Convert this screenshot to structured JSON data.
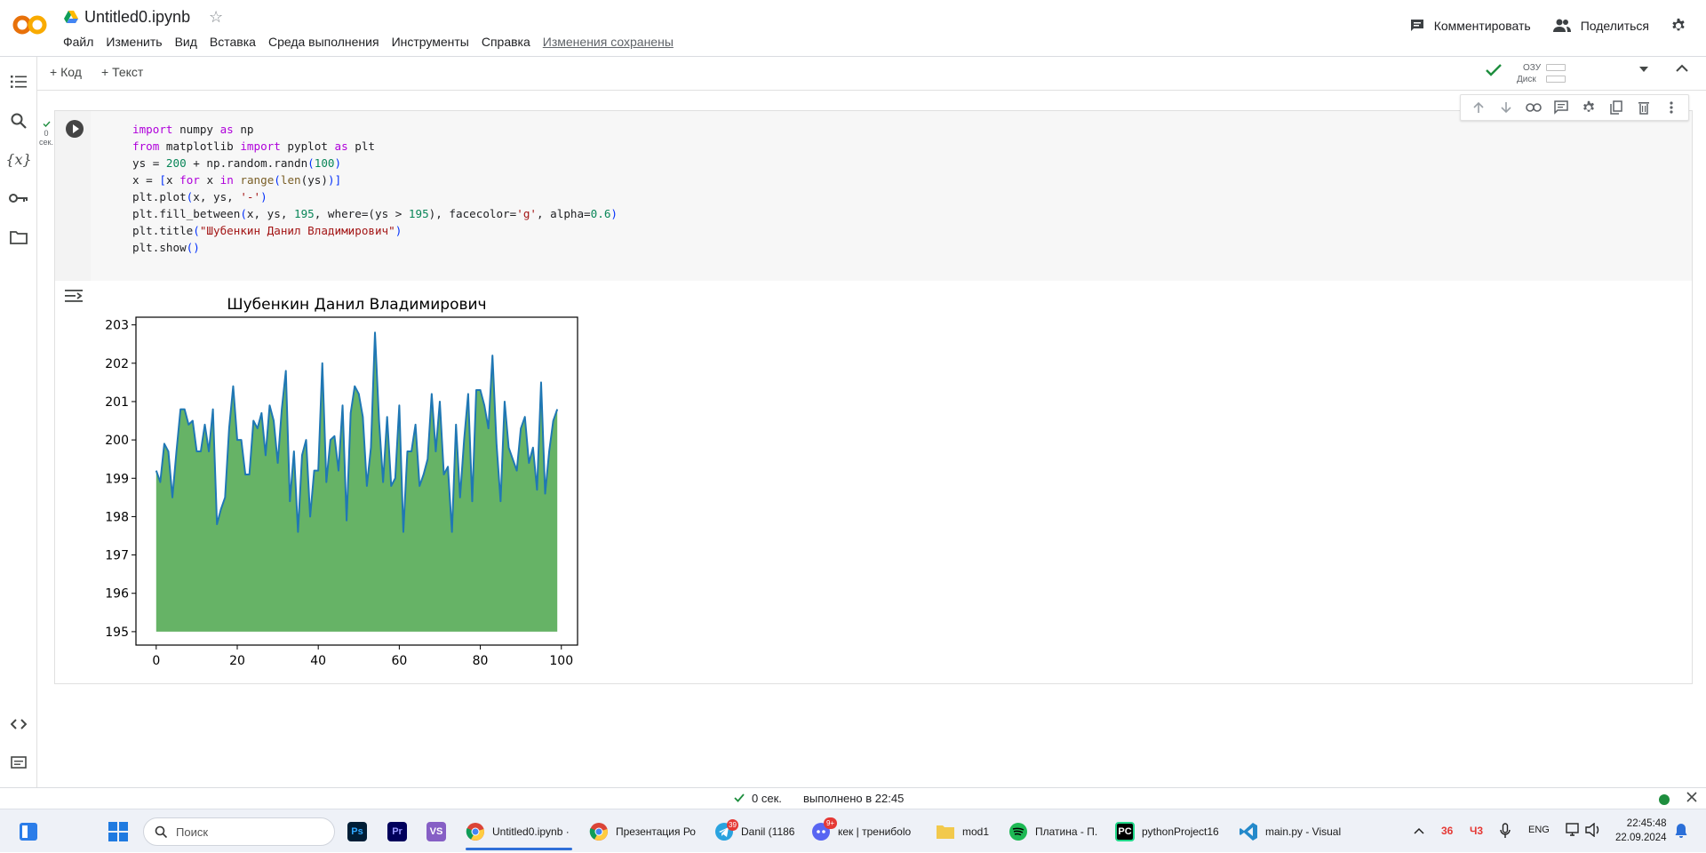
{
  "header": {
    "notebook_title": "Untitled0.ipynb",
    "menu": [
      "Файл",
      "Изменить",
      "Вид",
      "Вставка",
      "Среда выполнения",
      "Инструменты",
      "Справка"
    ],
    "saved_status": "Изменения сохранены",
    "comment_label": "Комментировать",
    "share_label": "Поделиться"
  },
  "toolbar": {
    "add_code": "+ Код",
    "add_text": "+ Текст",
    "ram_label": "ОЗУ",
    "disk_label": "Диск"
  },
  "cell": {
    "exec_count": "0",
    "exec_unit": "сек.",
    "code_lines": [
      "import numpy as np",
      "from matplotlib import pyplot as plt",
      "ys = 200 + np.random.randn(100)",
      "x = [x for x in range(len(ys))]",
      "plt.plot(x, ys, '-')",
      "plt.fill_between(x, ys, 195, where=(ys > 195), facecolor='g', alpha=0.6)",
      "plt.title(\"Шубенкин Данил Владимирович\")",
      "plt.show()"
    ]
  },
  "chart_data": {
    "type": "area",
    "title": "Шубенкин Данил Владимирович",
    "xlabel": "",
    "ylabel": "",
    "xlim": [
      -5,
      104
    ],
    "ylim": [
      194.65,
      203.2
    ],
    "xticks": [
      0,
      20,
      40,
      60,
      80,
      100
    ],
    "yticks": [
      195,
      196,
      197,
      198,
      199,
      200,
      201,
      202,
      203
    ],
    "fill_baseline": 195,
    "fill_color": "#66b366",
    "line_color": "#1f77b4",
    "grid": false,
    "x": [
      0,
      1,
      2,
      3,
      4,
      5,
      6,
      7,
      8,
      9,
      10,
      11,
      12,
      13,
      14,
      15,
      16,
      17,
      18,
      19,
      20,
      21,
      22,
      23,
      24,
      25,
      26,
      27,
      28,
      29,
      30,
      31,
      32,
      33,
      34,
      35,
      36,
      37,
      38,
      39,
      40,
      41,
      42,
      43,
      44,
      45,
      46,
      47,
      48,
      49,
      50,
      51,
      52,
      53,
      54,
      55,
      56,
      57,
      58,
      59,
      60,
      61,
      62,
      63,
      64,
      65,
      66,
      67,
      68,
      69,
      70,
      71,
      72,
      73,
      74,
      75,
      76,
      77,
      78,
      79,
      80,
      81,
      82,
      83,
      84,
      85,
      86,
      87,
      88,
      89,
      90,
      91,
      92,
      93,
      94,
      95,
      96,
      97,
      98,
      99
    ],
    "values": [
      199.2,
      198.9,
      199.9,
      199.7,
      198.5,
      199.7,
      200.8,
      200.8,
      200.4,
      200.5,
      199.7,
      199.7,
      200.4,
      199.7,
      200.8,
      197.8,
      198.2,
      198.5,
      200.3,
      201.4,
      200.0,
      200.0,
      199.1,
      199.1,
      200.5,
      200.3,
      200.7,
      199.6,
      200.9,
      200.5,
      199.4,
      200.8,
      201.8,
      198.4,
      199.7,
      197.6,
      199.6,
      200.0,
      198.0,
      199.2,
      199.2,
      202.0,
      198.9,
      200.0,
      200.1,
      199.2,
      200.9,
      197.9,
      200.7,
      201.4,
      201.2,
      200.6,
      198.8,
      199.8,
      202.8,
      200.5,
      198.9,
      200.6,
      198.8,
      199.0,
      200.9,
      197.6,
      199.7,
      199.7,
      200.4,
      198.8,
      199.1,
      199.5,
      201.2,
      199.7,
      201.0,
      199.1,
      199.3,
      197.6,
      200.4,
      198.5,
      200.0,
      201.2,
      198.4,
      201.3,
      201.3,
      200.9,
      200.3,
      202.2,
      199.9,
      198.4,
      201.0,
      199.8,
      199.5,
      199.2,
      200.3,
      200.6,
      199.4,
      199.8,
      198.7,
      201.5,
      198.6,
      199.7,
      200.5,
      200.8
    ]
  },
  "status": {
    "exec_time": "0 сек.",
    "completed": "выполнено в 22:45"
  },
  "taskbar": {
    "search_placeholder": "Поиск",
    "apps": [
      {
        "label": "Untitled0.ipynb ·"
      },
      {
        "label": "Презентация Ро"
      },
      {
        "label": "Danil (1186"
      },
      {
        "label": "кек | тренибоlo"
      },
      {
        "label": "mod1"
      },
      {
        "label": "Платина - П."
      },
      {
        "label": "pythonProject16"
      },
      {
        "label": "main.py - Visual"
      }
    ],
    "telegram_badge": "39",
    "discord_badge": "9+",
    "temp": "36",
    "ch": "Ч3",
    "lang": "ENG",
    "time": "22:45:48",
    "date": "22.09.2024"
  },
  "colors": {
    "colab_orange": "#f9ab00",
    "colab_dark_orange": "#e8710a",
    "ok_green": "#1e8e3e"
  }
}
